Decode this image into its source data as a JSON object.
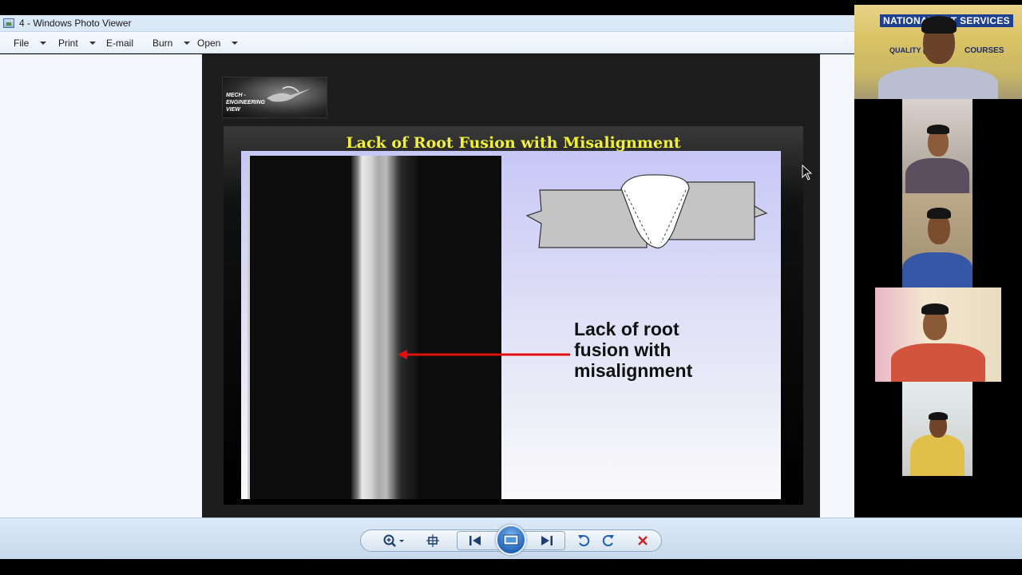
{
  "window": {
    "title": "4 - Windows Photo Viewer"
  },
  "menu": {
    "file": "File",
    "print": "Print",
    "email": "E-mail",
    "burn": "Burn",
    "open": "Open"
  },
  "slide": {
    "logo_text": "MECH - ENGINEERING VIEW",
    "title": "Lack of Root Fusion with Misalignment",
    "annotation": "Lack of root\nfusion with\nmisalignment"
  },
  "toolbar": {
    "icons": [
      "zoom-icon",
      "actual-size-icon",
      "previous-icon",
      "slideshow-icon",
      "next-icon",
      "rotate-left-icon",
      "rotate-right-icon",
      "delete-icon"
    ]
  },
  "video": {
    "banner_title": "NATIONAL NDT SERVICES",
    "banner_line1": "QUALITY (QA/QC)",
    "banner_line2": "COURSES"
  },
  "colors": {
    "slide_title": "#f2f03a",
    "arrow": "#e01010",
    "toolbar_bg": "#c7d9ec",
    "delete": "#d22020"
  }
}
